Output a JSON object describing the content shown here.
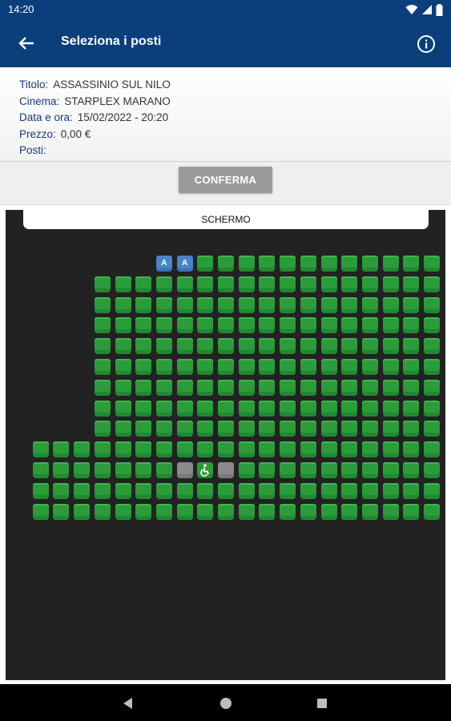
{
  "status_bar": {
    "time": "14:20",
    "icons": [
      "wifi-icon",
      "signal-icon",
      "battery-icon"
    ]
  },
  "app_bar": {
    "title": "Seleziona i posti",
    "back_icon": "arrow-left-icon",
    "info_icon": "info-icon"
  },
  "details": [
    {
      "label": "Titolo:",
      "value": "ASSASSINIO SUL NILO"
    },
    {
      "label": "Cinema:",
      "value": "STARPLEX MARANO"
    },
    {
      "label": "Data e ora:",
      "value": "15/02/2022 - 20:20"
    },
    {
      "label": "Prezzo:",
      "value": "0,00 €"
    },
    {
      "label": "Posti:",
      "value": ""
    }
  ],
  "confirm_label": "CONFERMA",
  "screen_label": "SCHERMO",
  "reserved_seat_label": "A",
  "colors": {
    "header": "#0a3f7c",
    "seat_free": "#2a9d3a",
    "seat_occupied": "#8a8a8a",
    "seat_reserved": "#4a84c9",
    "hall": "#222222"
  },
  "seat_map": {
    "legend": {
      "o": "free",
      "x": "occupied",
      "w": "wheelchair",
      "A": "reserved",
      ".": "none"
    },
    "rows": [
      ".......AAoooooooooooo",
      "....ooooooooooooooooo",
      "....ooooooooooooooooo",
      "....ooooooooooooooooo",
      "....ooooooooooooooooo",
      "....ooooooooooooooooo",
      "....ooooooooooooooooo",
      "....ooooooooooooooooo",
      "....ooooooooooooooooo",
      ".oooooooooooooooooooo",
      ".oooooooxwxoooooooooo",
      ".oooooooooooooooooooo",
      ".oooooooooooooooooooo"
    ]
  },
  "nav_bar": {
    "buttons": [
      "back-triangle-icon",
      "home-circle-icon",
      "recents-square-icon"
    ]
  }
}
